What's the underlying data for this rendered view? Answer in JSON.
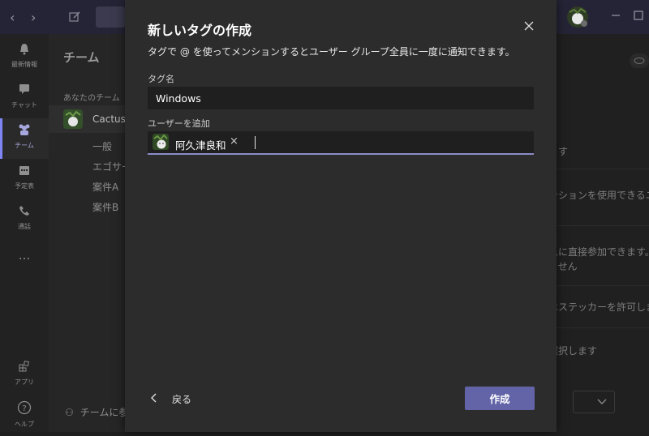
{
  "background": {
    "rail_items": [
      {
        "label": "最新情報",
        "icon": "bell-icon"
      },
      {
        "label": "チャット",
        "icon": "chat-icon"
      },
      {
        "label": "チーム",
        "icon": "teams-icon",
        "active": true
      },
      {
        "label": "予定表",
        "icon": "calendar-icon"
      },
      {
        "label": "通話",
        "icon": "phone-icon"
      },
      {
        "label": "...",
        "icon": "more-icon"
      },
      {
        "label": "アプリ",
        "icon": "apps-icon"
      },
      {
        "label": "ヘルプ",
        "icon": "help-icon"
      }
    ],
    "teams_panel": {
      "heading": "チーム",
      "section_label": "あなたのチーム",
      "team_name": "Cactus",
      "channels": [
        "一般",
        "エゴサーチ",
        "案件A",
        "案件B"
      ],
      "footer": "チームに参加"
    },
    "right_pane_rows": [
      "ます",
      "ンションを使用できるユー",
      "ムに直接参加できます。",
      "ません",
      "はステッカーを許可しま",
      "選択します"
    ]
  },
  "dialog": {
    "title": "新しいタグの作成",
    "description": "タグで @ を使ってメンションするとユーザー グループ全員に一度に通知できます。",
    "tag_name_label": "タグ名",
    "tag_name_value": "Windows",
    "add_user_label": "ユーザーを追加",
    "selected_user": {
      "name": "阿久津良和",
      "remove_glyph": "×"
    },
    "back_label": "戻る",
    "create_label": "作成"
  },
  "colors": {
    "accent": "#6264a7",
    "input_underline": "#8b8cc7",
    "dialog_bg": "#2d2c2c",
    "input_bg": "#1f1f1f",
    "titlebar_bg": "#252436"
  }
}
